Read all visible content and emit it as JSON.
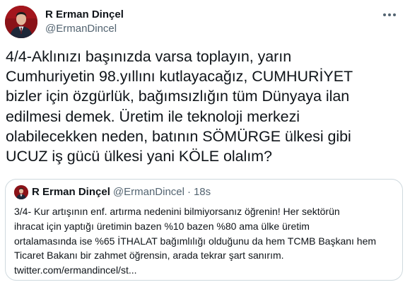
{
  "tweet": {
    "display_name": "R Erman Dinçel",
    "handle": "@ErmanDincel",
    "more_icon": "ellipsis-icon",
    "text_lines": [
      "4/4-Aklınızı başınızda varsa toplayın, yarın",
      "Cumhuriyetin 98.yıllını kutlayacağız, CUMHURİYET",
      "bizler için özgürlük, bağımsızlığın tüm Dünyaya ilan",
      "edilmesi demek. Üretim ile teknoloji merkezi",
      "olabilecekken neden, batının SÖMÜRGE ülkesi gibi",
      "UCUZ iş gücü ülkesi yani KÖLE olalım?"
    ]
  },
  "quoted_tweet": {
    "display_name": "R Erman Dinçel",
    "handle": "@ErmanDincel",
    "separator": "·",
    "time": "18s",
    "text_lines": [
      "3/4- Kur artışının enf. artırma nedenini bilmiyorsanız öğrenin! Her sektörün",
      "ihracat için yaptığı üretimin bazen %10 bazen %80 ama ülke üretim",
      "ortalamasında ise %65 İTHALAT bağımlılığı olduğunu da hem TCMB Başkanı hem",
      "Ticaret Bakanı bir zahmet öğrensin, arada tekrar şart sanırım.",
      "twitter.com/ermandincel/st..."
    ]
  },
  "colors": {
    "primary_text": "#0f1419",
    "secondary_text": "#536471",
    "border": "#cfd9de",
    "avatar_red": "#8a1218"
  }
}
